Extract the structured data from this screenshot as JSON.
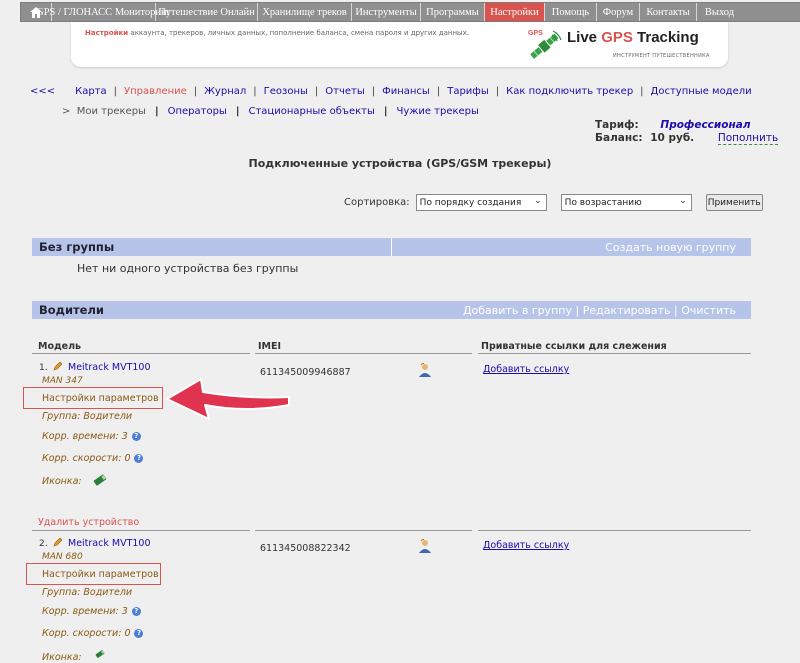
{
  "topnav": {
    "home_icon": "home-icon",
    "items": [
      "GPS / ГЛОНАСС Мониторинг",
      "Путешествие Онлайн",
      "Хранилище треков",
      "Инструменты",
      "Программы",
      "Настройки",
      "Помощь",
      "Форум",
      "Контакты",
      "Выход"
    ],
    "active": "Настройки"
  },
  "header": {
    "tagline_prefix": "Настройки",
    "tagline_rest": "аккаунта, трекеров, личных данных, пополнение баланса, смена пароля и других данных.",
    "logo_text_live": "Live",
    "logo_text_gps": "GPS",
    "logo_text_tracking": "Tracking",
    "logo_badge": "GPS",
    "logo_sub": "ИНСТРУМЕНТ ПУТЕШЕСТВЕННИКА"
  },
  "mainnav": {
    "back": "<<<",
    "items": [
      "Карта",
      "Управление",
      "Журнал",
      "Геозоны",
      "Отчеты",
      "Финансы",
      "Тарифы",
      "Как подключить трекер",
      "Доступные модели"
    ],
    "active": "Управление"
  },
  "subnav": {
    "prefix": ">",
    "current": "Мои трекеры",
    "items": [
      "Операторы",
      "Стационарные объекты",
      "Чужие трекеры"
    ]
  },
  "tariff": {
    "tariff_label": "Тариф:",
    "tariff_value": "Профессионал",
    "balance_label": "Баланс:",
    "balance_value": "10 руб.",
    "topup": "Пополнить"
  },
  "page_title": "Подключенные устройства (GPS/GSM трекеры)",
  "sorting": {
    "label": "Сортировка:",
    "order_by": "По порядку создания",
    "direction": "По возрастанию",
    "apply": "Применить"
  },
  "groups": {
    "no_group": {
      "name": "Без группы",
      "action": "Создать новую группу",
      "empty_message": "Нет ни одного устройства без группы"
    },
    "drivers": {
      "name": "Водители",
      "actions": [
        "Добавить в группу",
        "Редактировать",
        "Очистить"
      ],
      "separator": "|"
    }
  },
  "table": {
    "columns": [
      "Модель",
      "IMEI",
      "Приватные ссылки для слежения"
    ],
    "group_label": "Группа: Водители",
    "time_corr_label": "Корр. времени:",
    "speed_corr_label": "Корр. скорости:",
    "icon_label": "Иконка:",
    "settings_label": "Настройки параметров",
    "add_link_label": "Добавить ссылку",
    "delete_label": "Удалить устройство",
    "devices": [
      {
        "num": "1.",
        "model": "Meitrack MVT100",
        "plate": "MAN 347",
        "imei": "611345009946887",
        "time_corr": "3",
        "speed_corr": "0"
      },
      {
        "num": "2.",
        "model": "Meitrack MVT100",
        "plate": "MAN 680",
        "imei": "611345008822342",
        "time_corr": "3",
        "speed_corr": "0"
      }
    ]
  },
  "colors": {
    "accent_red": "#d9534f",
    "link_blue": "#1a0dab",
    "group_bar": "#b7c4ea",
    "menu_gray": "#8f8f8f"
  }
}
